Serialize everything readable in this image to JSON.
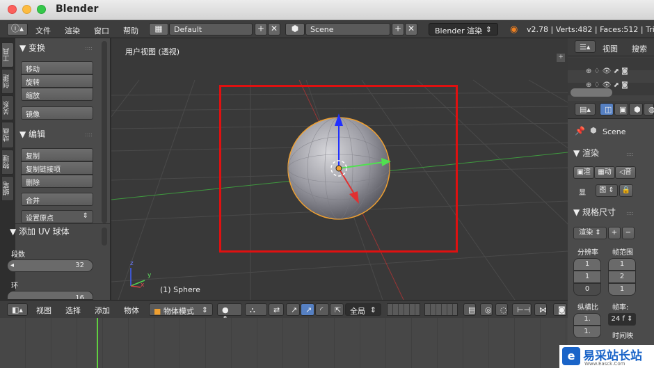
{
  "window": {
    "title": "Blender"
  },
  "infobar": {
    "menus": [
      "文件",
      "渲染",
      "窗口",
      "帮助"
    ],
    "screen_layout": "Default",
    "scene": "Scene",
    "render_engine": "Blender 渲染",
    "stats": "v2.78 | Verts:482 | Faces:512 | Tris"
  },
  "left_tabs": [
    "工具",
    "创建",
    "关系",
    "动画",
    "物理",
    "蜡笔"
  ],
  "toolshelf": {
    "transform": {
      "header": "▼ 变换",
      "buttons": [
        "移动",
        "旋转",
        "缩放"
      ],
      "mirror": "镜像"
    },
    "edit": {
      "header": "▼ 编辑",
      "buttons": [
        "复制",
        "复制链接项",
        "删除"
      ],
      "join": "合并",
      "origin": "设置原点"
    },
    "operator": {
      "header": "▼ 添加 UV 球体",
      "segments_label": "段数",
      "segments_value": "32",
      "rings_label": "环",
      "rings_value": "16"
    }
  },
  "viewport": {
    "title": "用户视图 (透视)",
    "object_label": "(1) Sphere",
    "axis_x": "x",
    "axis_y": "y",
    "axis_z": "z"
  },
  "view3d_header": {
    "menus": [
      "视图",
      "选择",
      "添加",
      "物体"
    ],
    "mode": "物体模式",
    "orientation": "全局"
  },
  "outliner": {
    "menus": [
      "视图",
      "搜索"
    ]
  },
  "properties": {
    "scene_name": "Scene",
    "render_header": "▼ 渲染",
    "render_buttons": [
      "渲",
      "动",
      "音"
    ],
    "display_label": "显",
    "display_value": "图",
    "dimensions_header": "▼ 规格尺寸",
    "preset": "渲染",
    "resolution_label": "分辨率",
    "frame_range_label": "帧范围",
    "res_values": [
      "1",
      "1",
      "0"
    ],
    "frame_values": [
      "1",
      "2",
      "1"
    ],
    "aspect_label": "纵横比",
    "fps_label": "帧率:",
    "aspect_value": "1.",
    "aspect_value2": "1.",
    "fps_value": "24 f",
    "time_remap": "时间映"
  },
  "watermark": {
    "text": "易采站长站",
    "sub": "Www.Easck.Com"
  },
  "colors": {
    "selection_box": "#e01010",
    "x_axis": "#e03030",
    "y_axis": "#50e050",
    "z_axis": "#2030ff",
    "selected_outline": "#f0a030"
  }
}
